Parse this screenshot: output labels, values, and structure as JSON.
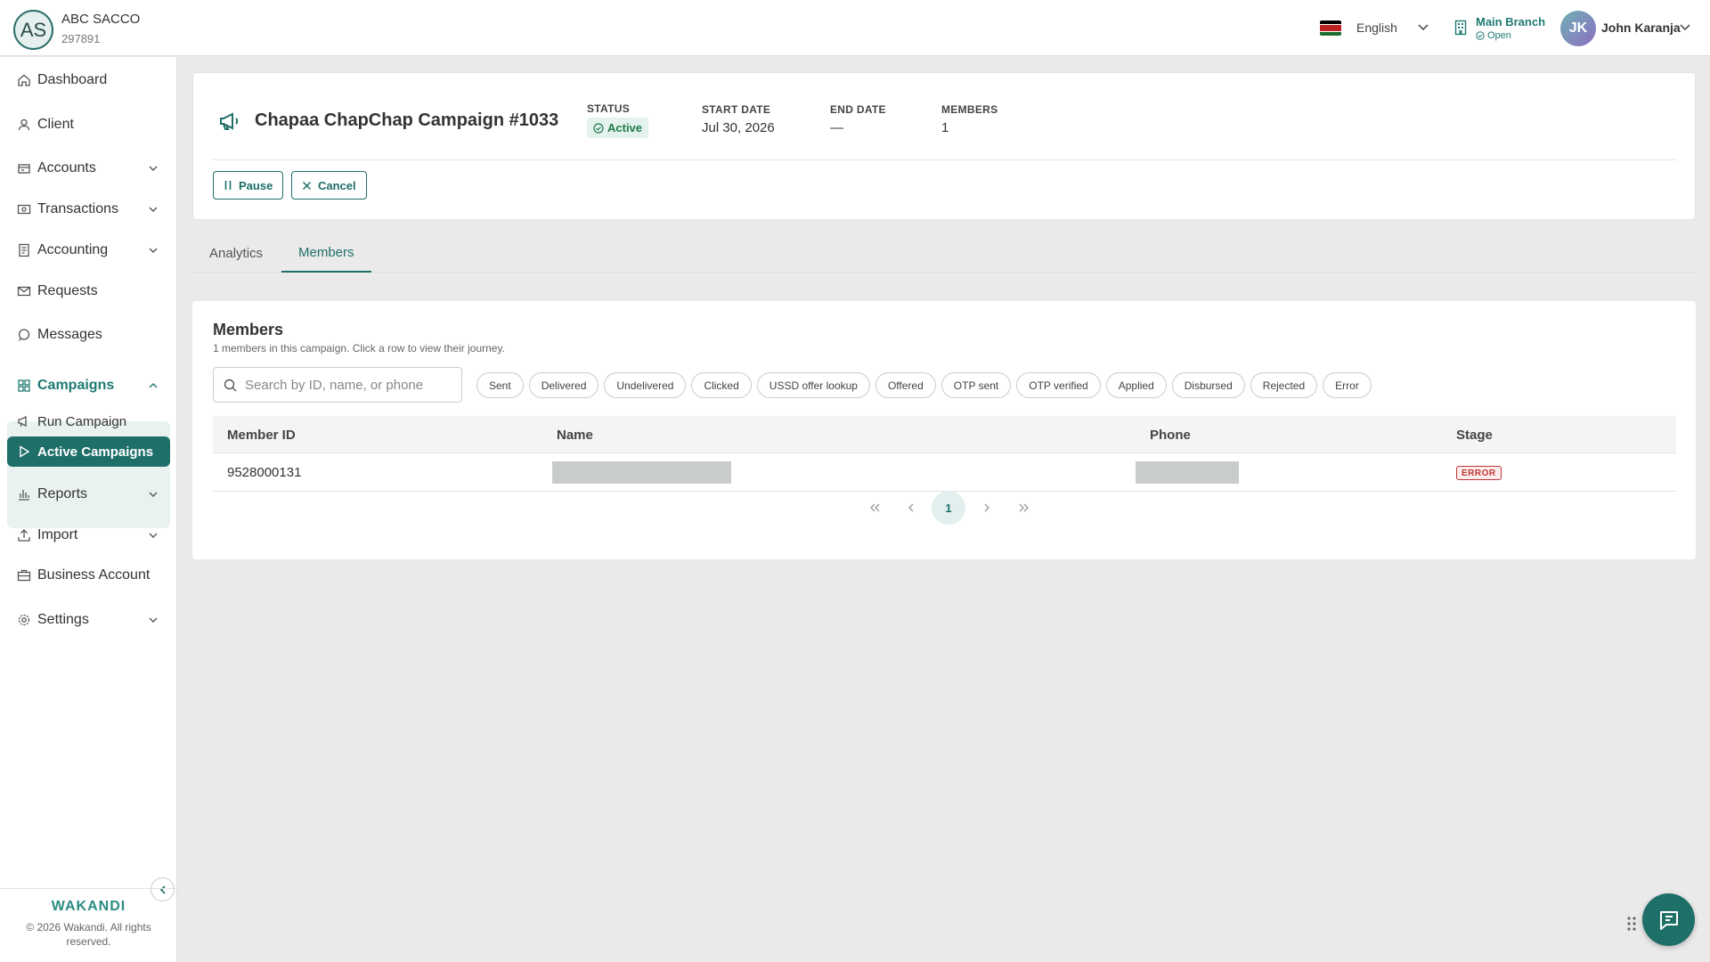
{
  "org": {
    "initials": "AS",
    "name": "ABC SACCO",
    "id": "297891"
  },
  "header": {
    "language": "English",
    "branch_name": "Main Branch",
    "branch_status": "Open",
    "user_initials": "JK",
    "user_name": "John Karanja"
  },
  "sidebar": {
    "items": [
      {
        "label": "Dashboard"
      },
      {
        "label": "Client"
      },
      {
        "label": "Accounts"
      },
      {
        "label": "Transactions"
      },
      {
        "label": "Accounting"
      },
      {
        "label": "Requests"
      },
      {
        "label": "Messages"
      },
      {
        "label": "Campaigns"
      },
      {
        "label": "Run Campaign"
      },
      {
        "label": "Active Campaigns"
      },
      {
        "label": "Reports"
      },
      {
        "label": "Import"
      },
      {
        "label": "Business Account"
      },
      {
        "label": "Settings"
      }
    ],
    "footer_logo": "WAKANDI",
    "footer_copyright": "© 2026 Wakandi. All rights reserved."
  },
  "campaign": {
    "title": "Chapaa ChapChap Campaign #1033",
    "status_label": "STATUS",
    "status_value": "Active",
    "start_date_label": "START DATE",
    "start_date_value": "Jul 30, 2026",
    "end_date_label": "END DATE",
    "end_date_value": "—",
    "members_label": "MEMBERS",
    "members_value": "1",
    "pause_label": "Pause",
    "cancel_label": "Cancel"
  },
  "tabs": [
    {
      "label": "Analytics"
    },
    {
      "label": "Members"
    }
  ],
  "members": {
    "title": "Members",
    "subtitle": "1 members in this campaign. Click a row to view their journey.",
    "search_placeholder": "Search by ID, name, or phone",
    "filters": [
      "Sent",
      "Delivered",
      "Undelivered",
      "Clicked",
      "USSD offer lookup",
      "Offered",
      "OTP sent",
      "OTP verified",
      "Applied",
      "Disbursed",
      "Rejected",
      "Error"
    ],
    "columns": [
      "Member ID",
      "Name",
      "Phone",
      "Stage"
    ],
    "rows": [
      {
        "member_id": "9528000131",
        "stage": "ERROR"
      }
    ],
    "current_page": "1"
  },
  "colors": {
    "primary": "#1f6f69",
    "error": "#c43636",
    "success": "#1e7a4f"
  }
}
